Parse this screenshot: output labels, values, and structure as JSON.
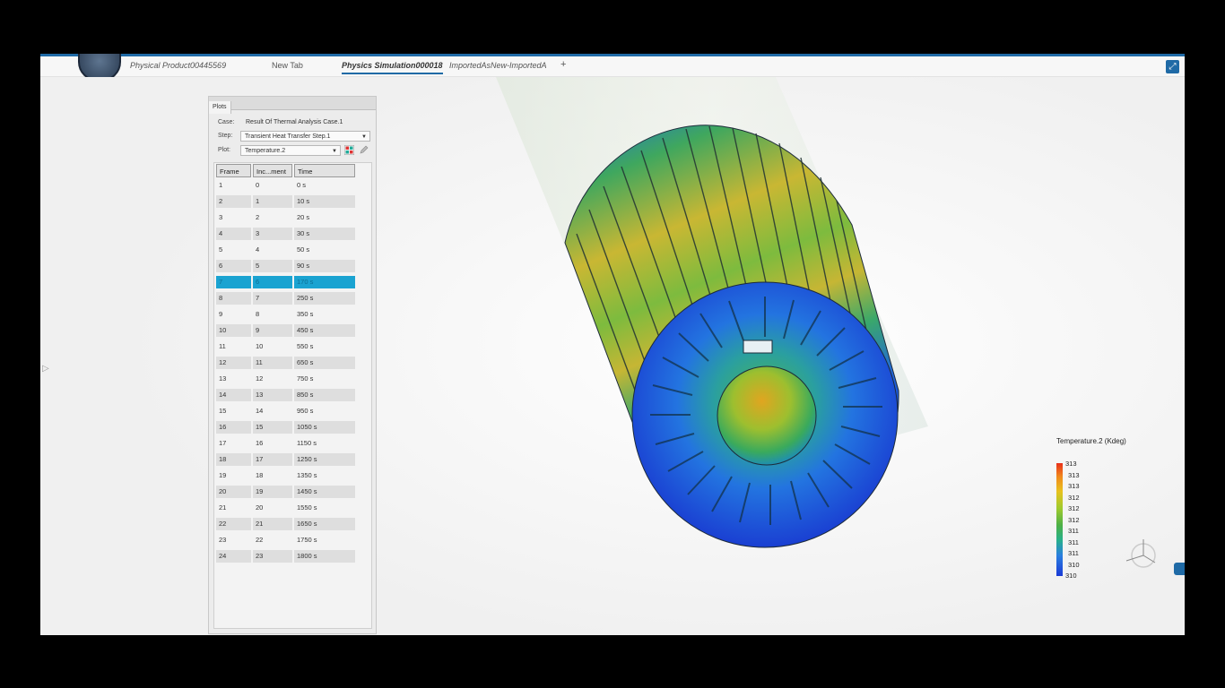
{
  "tabs": [
    {
      "label": "Physical Product00445569",
      "active": false
    },
    {
      "label": "New Tab",
      "active": false
    },
    {
      "label": "Physics Simulation000018",
      "active": true
    },
    {
      "label": "ImportedAsNew-ImportedA",
      "active": false
    }
  ],
  "add_tab": "+",
  "plots_panel": {
    "tab_label": "Plots",
    "case_label": "Case:",
    "case_value": "Result Of Thermal Analysis Case.1",
    "step_label": "Step:",
    "step_value": "Transient Heat Transfer Step.1",
    "plot_label": "Plot:",
    "plot_value": "Temperature.2"
  },
  "table": {
    "headers": [
      "Frame",
      "Inc...ment",
      "Time"
    ],
    "rows": [
      [
        "1",
        "0",
        "0 s"
      ],
      [
        "2",
        "1",
        "10 s"
      ],
      [
        "3",
        "2",
        "20 s"
      ],
      [
        "4",
        "3",
        "30 s"
      ],
      [
        "5",
        "4",
        "50 s"
      ],
      [
        "6",
        "5",
        "90 s"
      ],
      [
        "7",
        "6",
        "170 s"
      ],
      [
        "8",
        "7",
        "250 s"
      ],
      [
        "9",
        "8",
        "350 s"
      ],
      [
        "10",
        "9",
        "450 s"
      ],
      [
        "11",
        "10",
        "550 s"
      ],
      [
        "12",
        "11",
        "650 s"
      ],
      [
        "13",
        "12",
        "750 s"
      ],
      [
        "14",
        "13",
        "850 s"
      ],
      [
        "15",
        "14",
        "950 s"
      ],
      [
        "16",
        "15",
        "1050 s"
      ],
      [
        "17",
        "16",
        "1150 s"
      ],
      [
        "18",
        "17",
        "1250 s"
      ],
      [
        "19",
        "18",
        "1350 s"
      ],
      [
        "20",
        "19",
        "1450 s"
      ],
      [
        "21",
        "20",
        "1550 s"
      ],
      [
        "22",
        "21",
        "1650 s"
      ],
      [
        "23",
        "22",
        "1750 s"
      ],
      [
        "24",
        "23",
        "1800 s"
      ]
    ],
    "selected_index": 6
  },
  "legend": {
    "title": "Temperature.2 (Kdeg)",
    "ticks": [
      "313",
      "313",
      "313",
      "312",
      "312",
      "312",
      "311",
      "311",
      "311",
      "310",
      "310"
    ]
  },
  "colors": {
    "accent": "#1f6aa6",
    "selection": "#1aa3d1"
  },
  "icons": {
    "compass": "compass-icon",
    "expand": "expand-icon",
    "plot_options": "plot-options-icon",
    "edit": "pencil-icon"
  }
}
